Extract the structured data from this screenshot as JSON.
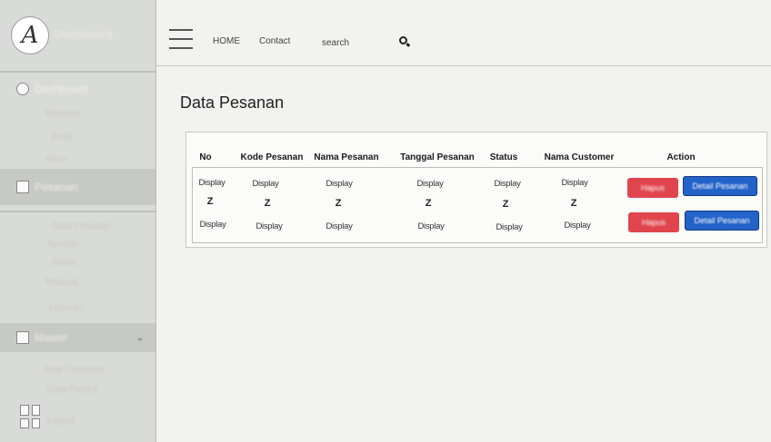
{
  "sidebar": {
    "logo_letter": "A",
    "brand": "Dashboard",
    "sections": [
      {
        "label": "Dashboard",
        "subs": [
          "Beranda",
          "Profil",
          "Akun"
        ]
      },
      {
        "label": "Pesanan",
        "subs": [
          "Data Pesanan",
          "Tambah",
          "Status",
          "Riwayat",
          "Laporan"
        ]
      },
      {
        "label": "Master",
        "subs": [
          "Data Customer",
          "Data Produk"
        ]
      }
    ],
    "bottom_label": "Logout"
  },
  "nav": {
    "home": "HOME",
    "contact": "Contact",
    "search": "search"
  },
  "main": {
    "title": "Data Pesanan",
    "columns": [
      "No",
      "Kode Pesanan",
      "Nama Pesanan",
      "Tanggal Pesanan",
      "Status",
      "Nama Customer",
      "Action"
    ],
    "rows": [
      [
        "Display",
        "Display",
        "Display",
        "Display",
        "Display",
        "Display"
      ],
      [
        "Display",
        "Display",
        "Display",
        "Display",
        "Display",
        "Display"
      ]
    ],
    "separator": "Z",
    "delete_label": "Hapus",
    "detail_label": "Detail Pesanan"
  },
  "colors": {
    "danger": "#e0444c",
    "primary": "#2262c9",
    "sidebar_bg": "#d9dbd8"
  }
}
